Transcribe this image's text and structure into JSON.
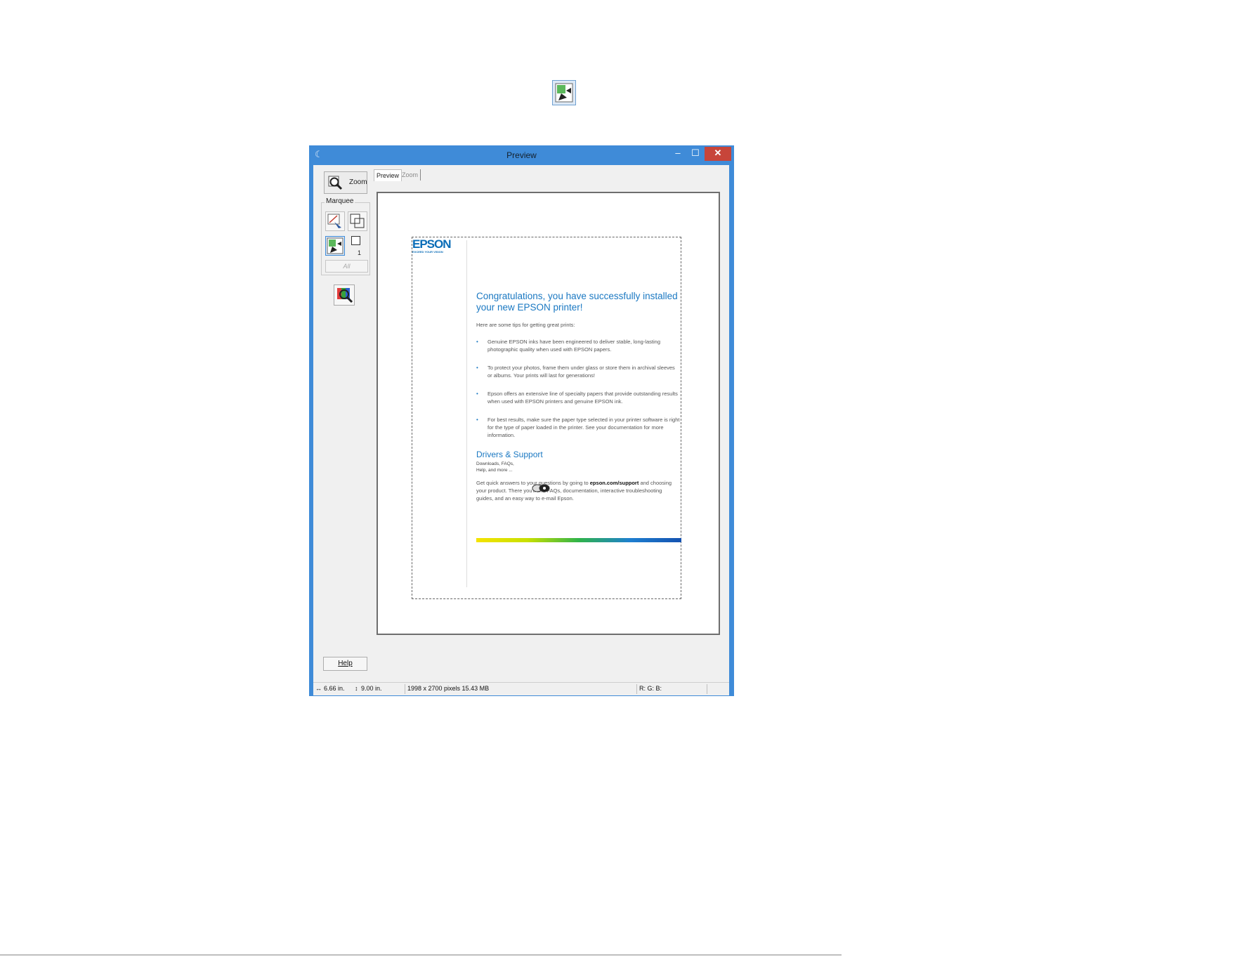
{
  "window": {
    "title": "Preview",
    "controls": {
      "minimize": "‒",
      "maximize": "☐",
      "close": "✕"
    }
  },
  "left_panel": {
    "zoom_label": "Zoom",
    "marquee": {
      "legend": "Marquee",
      "count": "1",
      "all_label": "All"
    },
    "help_label": "Help"
  },
  "tabs": [
    {
      "label": "Preview",
      "active": true
    },
    {
      "label": "Zoom",
      "active": false
    }
  ],
  "document": {
    "logo": "EPSON",
    "tagline": "EXCEED YOUR VISION",
    "heading": "Congratulations, you have successfully installed your new EPSON printer!",
    "intro": "Here are some tips for getting great prints:",
    "tips": [
      "Genuine EPSON inks have been engineered to deliver stable, long-lasting photographic quality when used with EPSON papers.",
      "To protect your photos, frame them under glass or store them in archival sleeves or albums. Your prints will last for generations!",
      "Epson offers an extensive line of specialty papers that provide outstanding results when used with EPSON printers and genuine EPSON ink.",
      "For best results, make sure the paper type selected in your printer software is right for the type of paper loaded in the printer. See your documentation for more information."
    ],
    "support_heading": "Drivers & Support",
    "support_sub": "Downloads, FAQs, Help, and more ...",
    "support_body_pre": "Get quick answers to your questions by going to ",
    "support_link": "epson.com/support",
    "support_body_post": " and choosing your product. There you'll find FAQs, documentation, interactive troubleshooting guides, and an easy way to e-mail Epson."
  },
  "statusbar": {
    "width": "6.66 in.",
    "height": "9.00 in.",
    "pixels": "1998 x 2700 pixels 15.43 MB",
    "rgb": "R: G: B:"
  },
  "colors": {
    "titlebar": "#3f8bd8",
    "close_button": "#c7453a",
    "accent": "#1a78c2"
  },
  "icons": [
    "thumbnail-icon",
    "magnifier-icon",
    "marquee-draw-icon",
    "marquee-copy-icon",
    "auto-locate-icon",
    "auto-exposure-icon",
    "cd-icon",
    "width-arrow-icon",
    "height-arrow-icon"
  ]
}
